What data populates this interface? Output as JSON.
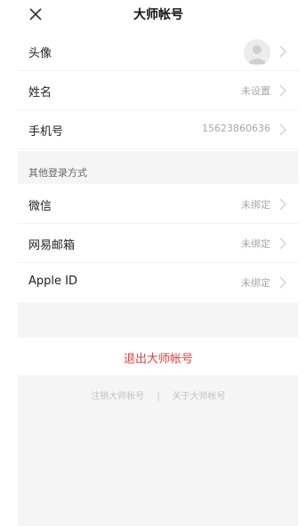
{
  "header": {
    "title": "大师帐号",
    "close_icon": "close-icon"
  },
  "profile": {
    "avatar_label": "头像",
    "name_label": "姓名",
    "name_value": "未设置",
    "phone_label": "手机号",
    "phone_value": "15623860636"
  },
  "login_methods": {
    "section_title": "其他登录方式",
    "items": [
      {
        "label": "微信",
        "status": "未绑定"
      },
      {
        "label": "网易邮箱",
        "status": "未绑定"
      },
      {
        "label": "Apple ID",
        "status": "未绑定"
      }
    ]
  },
  "actions": {
    "logout": "退出大师帐号",
    "cancel_account": "注销大师帐号",
    "separator": "|",
    "about_account": "关于大师帐号"
  },
  "colors": {
    "accent_red": "#e23d3d",
    "background_gray": "#f5f5f5",
    "muted_text": "#a7a7a7"
  }
}
